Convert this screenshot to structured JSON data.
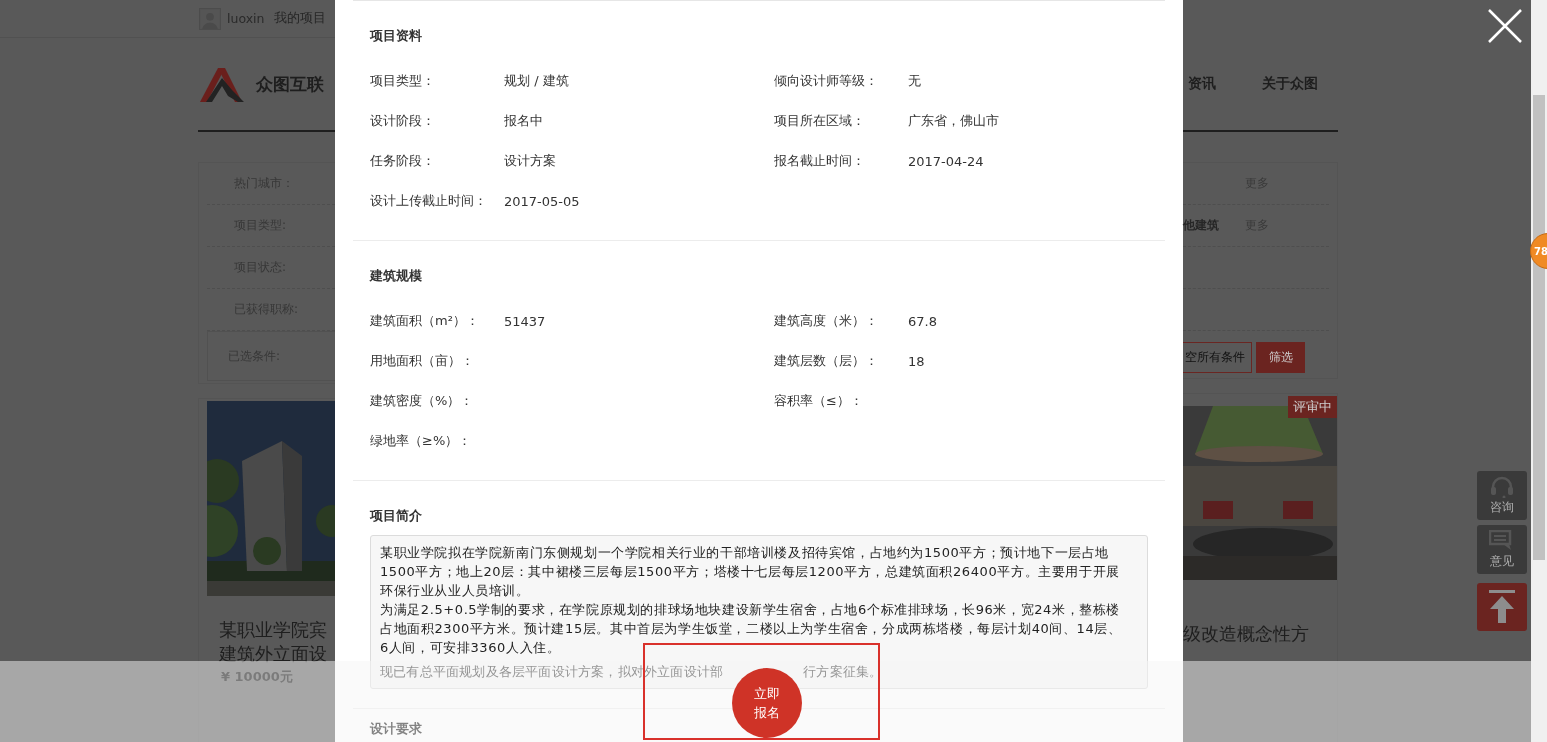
{
  "top_bar": {
    "username": "luoxin",
    "my_projects": "我的项目"
  },
  "logo": {
    "text": "众图互联"
  },
  "nav": [
    "资讯",
    "关于众图"
  ],
  "filters": {
    "rows": [
      {
        "label": "热门城市：",
        "tail": [
          "更多"
        ]
      },
      {
        "label": "项目类型:",
        "tail": [
          "他建筑",
          "更多"
        ]
      },
      {
        "label": "项目状态:"
      },
      {
        "label": "已获得职称:"
      }
    ],
    "selected_label": "已选条件:",
    "clear_button": "空所有条件",
    "filter_button": "筛选"
  },
  "cards": [
    {
      "title_lines": [
        "某职业学院宾",
        "建筑外立面设"
      ],
      "price": "¥ 10000元",
      "kind": "building"
    },
    {
      "badge": "评审中",
      "title_lines": [
        "级改造概念性方"
      ],
      "kind": "interior"
    }
  ],
  "modal": {
    "sections": [
      {
        "kind": "fields",
        "title": "项目资料",
        "fields": [
          {
            "label": "项目类型：",
            "value": "规划 / 建筑"
          },
          {
            "label": "倾向设计师等级：",
            "value": "无"
          },
          {
            "label": "设计阶段：",
            "value": "报名中"
          },
          {
            "label": "项目所在区域：",
            "value": "广东省，佛山市"
          },
          {
            "label": "任务阶段：",
            "value": "设计方案"
          },
          {
            "label": "报名截止时间：",
            "value": "2017-04-24"
          },
          {
            "label": "设计上传截止时间：",
            "value": "2017-05-05"
          }
        ]
      },
      {
        "kind": "fields",
        "title": "建筑规模",
        "fields": [
          {
            "label": "建筑面积（m²）：",
            "value": "51437"
          },
          {
            "label": "建筑高度（米）：",
            "value": "67.8"
          },
          {
            "label": "用地面积（亩）："
          },
          {
            "label": "建筑层数（层）：",
            "value": "18"
          },
          {
            "label": "建筑密度（%）："
          },
          {
            "label": "容积率（≤）："
          },
          {
            "label": "绿地率（≥%）："
          }
        ]
      },
      {
        "kind": "text",
        "title": "项目简介",
        "paragraphs": [
          "某职业学院拟在学院新南门东侧规划一个学院相关行业的干部培训楼及招待宾馆，占地约为1500平方；预计地下一层占地1500平方；地上20层：其中裙楼三层每层1500平方；塔楼十七层每层1200平方，总建筑面积26400平方。主要用于开展环保行业从业人员培训。",
          "为满足2.5+0.5学制的要求，在学院原规划的排球场地块建设新学生宿舍，占地6个标准排球场，长96米，宽24米，整栋楼占地面积2300平方米。预计建15层。其中首层为学生饭堂，二楼以上为学生宿舍，分成两栋塔楼，每层计划40间、14层、6人间，可安排3360人入住。"
        ],
        "covered_line": [
          "现已有总平面规划及各层平面设计方案，拟对外立面设计部",
          "行方案征集。"
        ]
      },
      {
        "kind": "heading",
        "title": "设计要求"
      }
    ]
  },
  "side_tools": [
    {
      "kind": "headset",
      "label": "咨询"
    },
    {
      "kind": "chat",
      "label": "意见"
    },
    {
      "kind": "top"
    }
  ],
  "edge_badge": "78",
  "action_button": [
    "立即",
    "报名"
  ]
}
